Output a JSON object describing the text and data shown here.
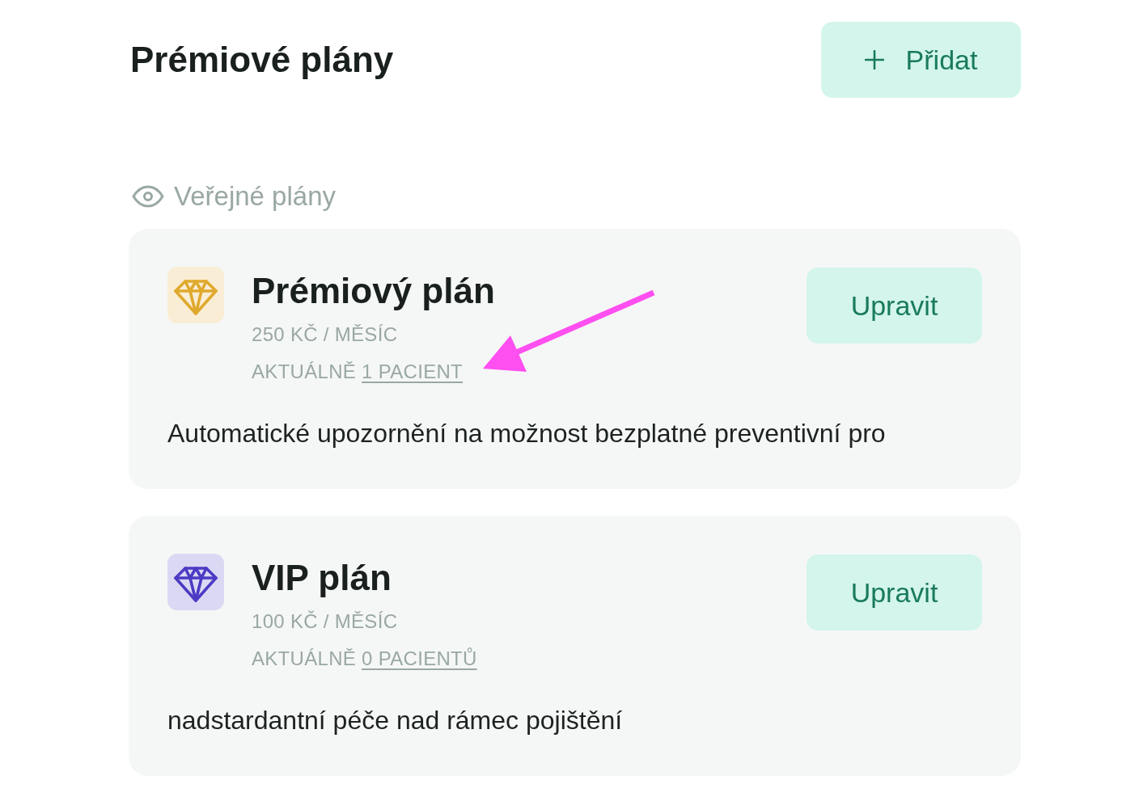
{
  "header": {
    "title": "Prémiové plány",
    "add_button": {
      "label": "Přidat"
    }
  },
  "section": {
    "title": "Veřejné plány"
  },
  "plans": [
    {
      "name": "Prémiový plán",
      "color": "#e0a92e",
      "price": "250 KČ / MĚSÍC",
      "patients_label": "AKTUÁLNĚ",
      "patients_link": "1 PACIENT",
      "description": "Automatické upozornění na možnost bezplatné preventivní pro",
      "edit_button": "Upravit"
    },
    {
      "name": "VIP plán",
      "color": "#4b3bc4",
      "price": "100 KČ / MĚSÍC",
      "patients_label": "AKTUÁLNĚ",
      "patients_link": "0 PACIENTŮ",
      "description": "nadstardantní péče nad rámec pojištění",
      "edit_button": "Upravit"
    }
  ]
}
